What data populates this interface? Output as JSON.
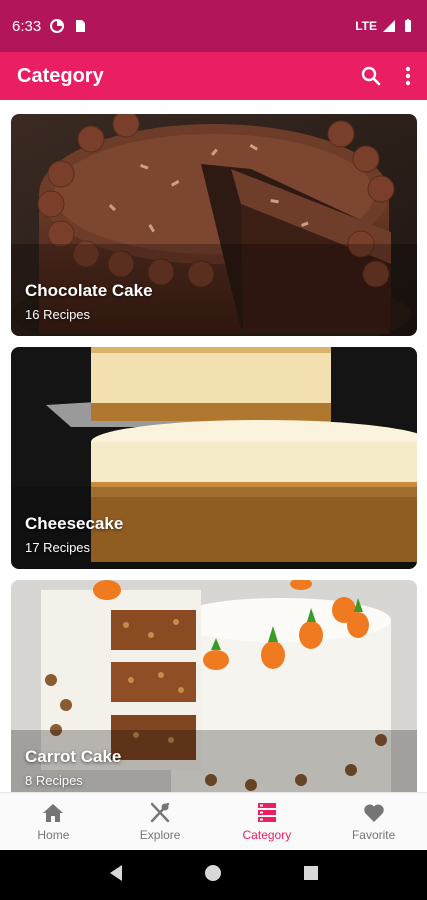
{
  "status_bar": {
    "time": "6:33",
    "network": "LTE",
    "background_color": "#b3155a"
  },
  "app_bar": {
    "title": "Category",
    "search_icon": "search-icon",
    "more_icon": "more-vert-icon",
    "background_color": "#e91e63"
  },
  "categories": [
    {
      "title": "Chocolate Cake",
      "count": "16 Recipes"
    },
    {
      "title": "Cheesecake",
      "count": "17 Recipes"
    },
    {
      "title": "Carrot Cake",
      "count": "8 Recipes"
    }
  ],
  "bottom_nav": {
    "items": [
      {
        "label": "Home",
        "icon": "home-icon"
      },
      {
        "label": "Explore",
        "icon": "fork-knife-icon"
      },
      {
        "label": "Category",
        "icon": "category-icon",
        "active": true
      },
      {
        "label": "Favorite",
        "icon": "heart-icon"
      }
    ],
    "active_color": "#e91e63"
  },
  "system_nav": [
    "back-icon",
    "home-circle-icon",
    "recents-icon"
  ]
}
